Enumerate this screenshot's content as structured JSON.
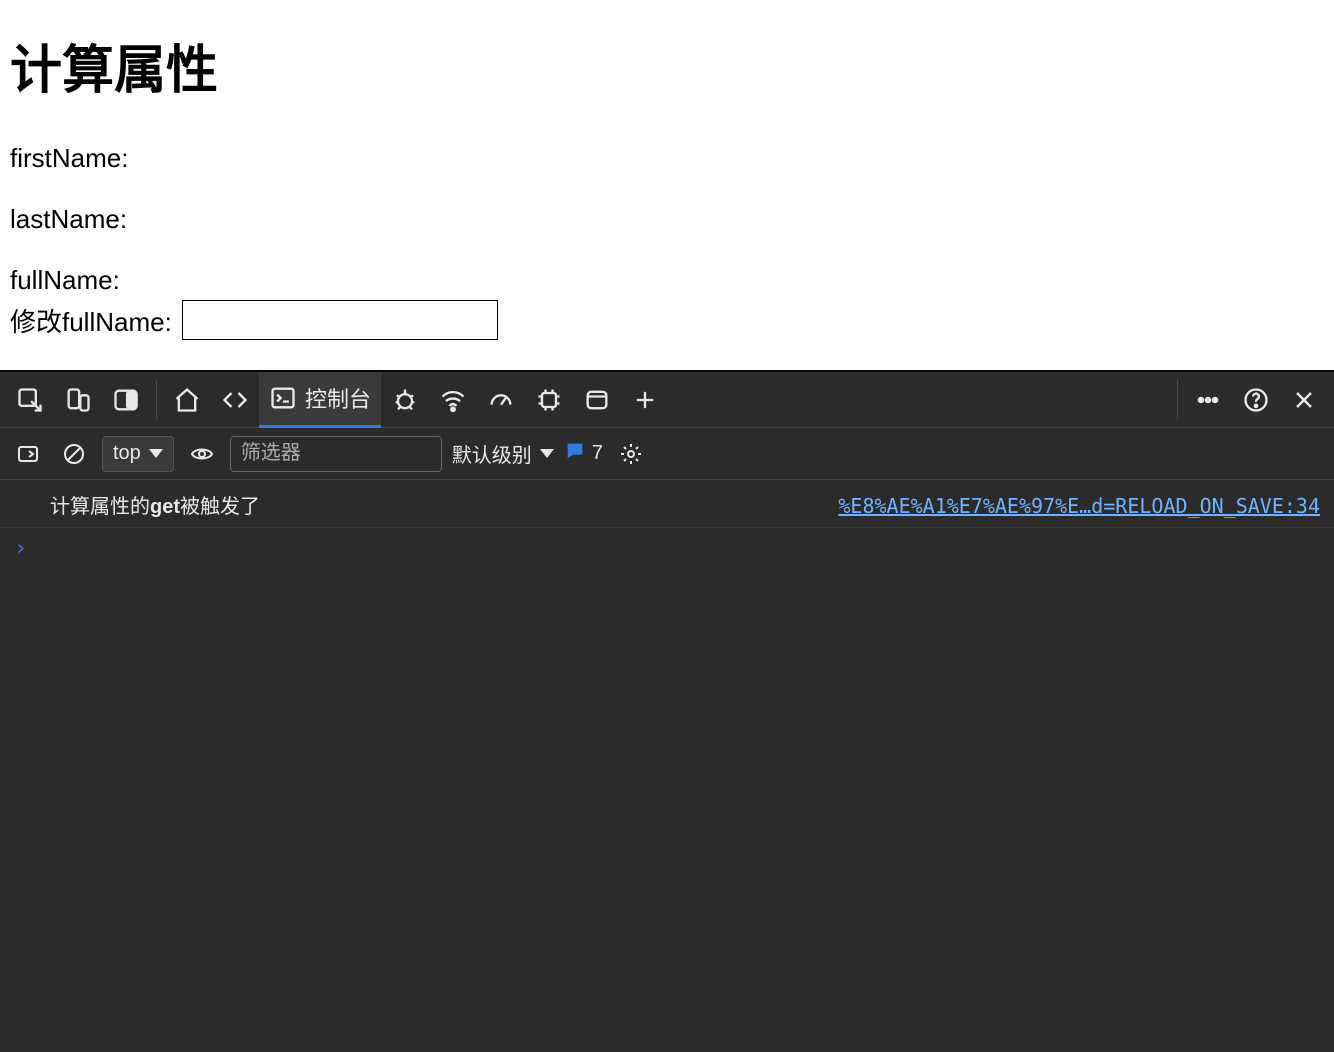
{
  "page": {
    "title": "计算属性",
    "labels": {
      "firstName": "firstName:",
      "lastName": "lastName:",
      "fullName": "fullName:",
      "editFullName": "修改fullName:"
    },
    "input_value": ""
  },
  "devtools": {
    "tabs": {
      "console_label": "控制台"
    },
    "toolbar": {
      "context": "top",
      "filter_placeholder": "筛选器",
      "level_label": "默认级别",
      "issues_count": "7"
    },
    "console": {
      "log_prefix": "计算属性的",
      "log_bold": "get",
      "log_suffix": "被触发了",
      "log_source": "%E8%AE%A1%E7%AE%97%E…d=RELOAD_ON_SAVE:34",
      "prompt": "›"
    }
  }
}
